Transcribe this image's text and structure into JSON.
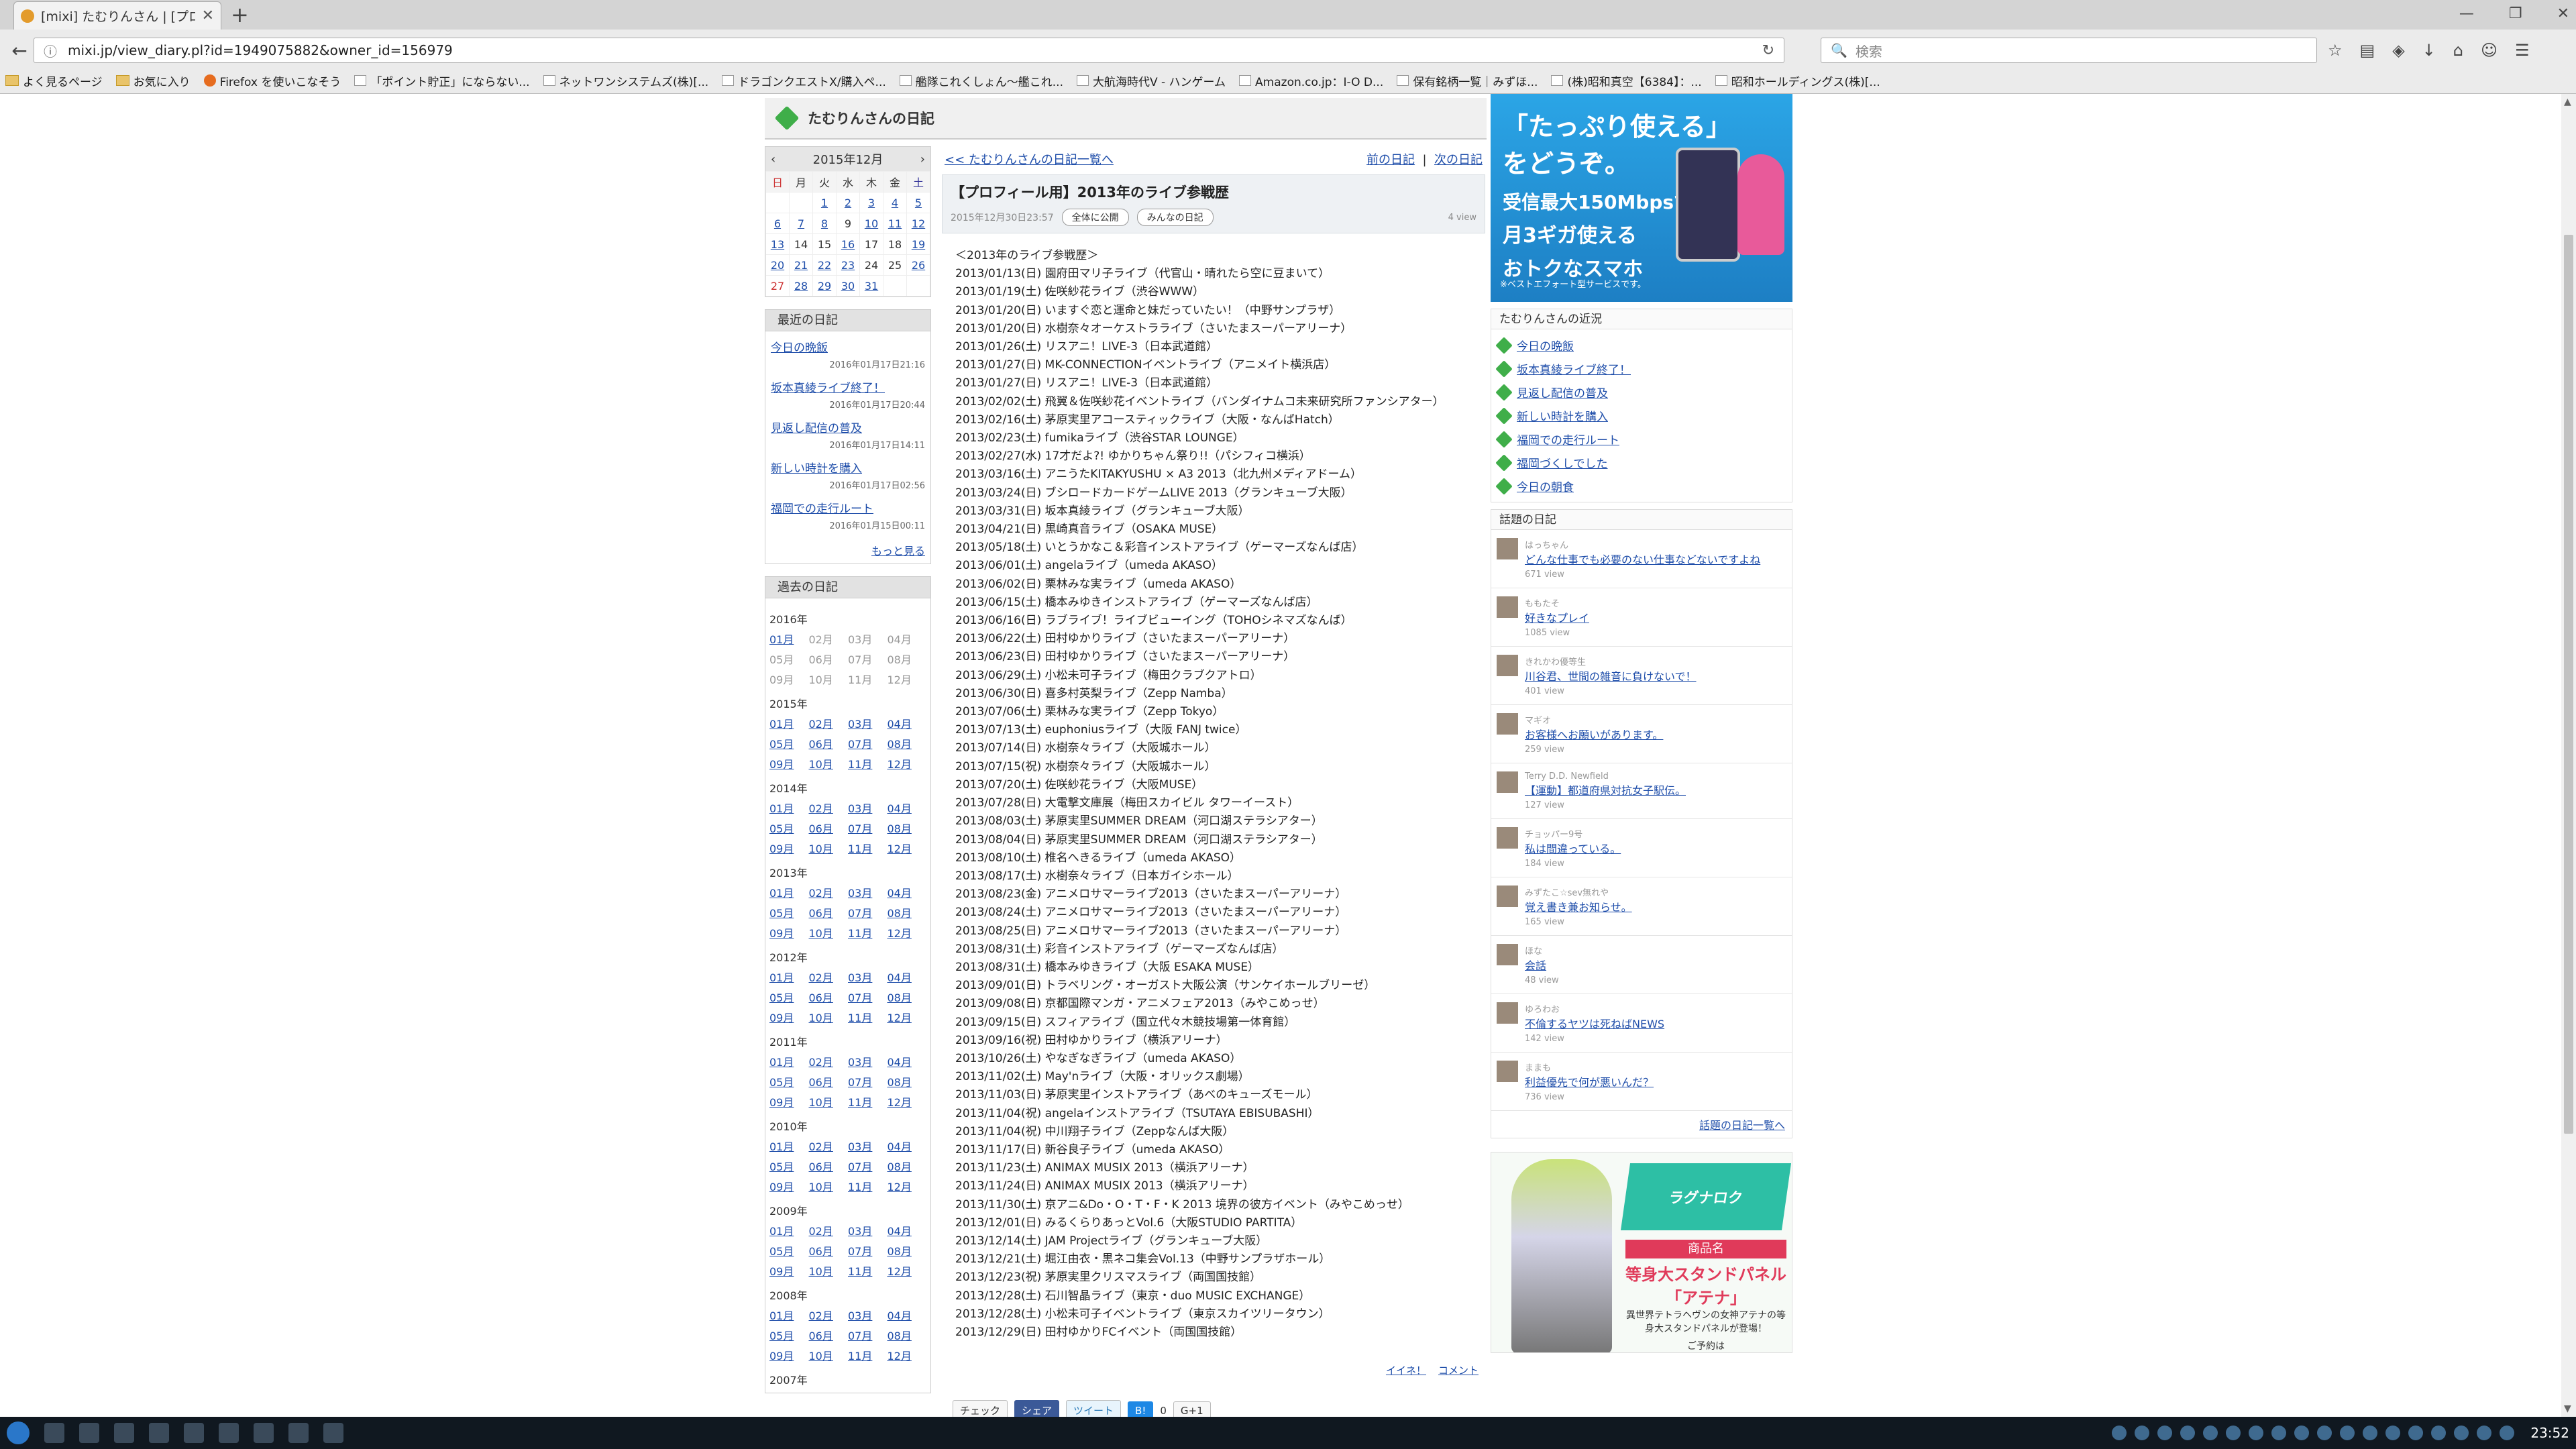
{
  "browser": {
    "tab_title": "[mixi] たむりんさん | [プロフィ...",
    "url": "mixi.jp/view_diary.pl?id=1949075882&owner_id=156979",
    "search_placeholder": "検索",
    "bookmarks": [
      "よく見るページ",
      "お気に入り",
      "Firefox を使いこなそう",
      "「ポイント貯正」にならない...",
      "ネットワンシステムズ(株)[...",
      "ドラゴンクエストX/購入ペ...",
      "艦隊これくしょん～艦これ...",
      "大航海時代Ⅴ - ハンゲーム",
      "Amazon.co.jp：I-O D...",
      "保有銘柄一覧｜みずほ...",
      "(株)昭和真空【6384】：...",
      "昭和ホールディングス(株)[..."
    ],
    "clock": "23:52"
  },
  "header": {
    "title": "たむりんさんの日記"
  },
  "calendar": {
    "month_label": "2015年12月",
    "weekdays": [
      "日",
      "月",
      "火",
      "水",
      "木",
      "金",
      "土"
    ],
    "weeks": [
      [
        "",
        "",
        "1",
        "2",
        "3",
        "4",
        "5"
      ],
      [
        "6",
        "7",
        "8",
        "9",
        "10",
        "11",
        "12"
      ],
      [
        "13",
        "14",
        "15",
        "16",
        "17",
        "18",
        "19"
      ],
      [
        "20",
        "21",
        "22",
        "23",
        "24",
        "25",
        "26"
      ],
      [
        "27",
        "28",
        "29",
        "30",
        "31",
        "",
        ""
      ]
    ]
  },
  "recent": {
    "title": "最近の日記",
    "items": [
      {
        "label": "今日の晩飯",
        "date": "2016年01月17日21:16"
      },
      {
        "label": "坂本真綾ライブ終了！",
        "date": "2016年01月17日20:44"
      },
      {
        "label": "見返し配信の普及",
        "date": "2016年01月17日14:11"
      },
      {
        "label": "新しい時計を購入",
        "date": "2016年01月17日02:56"
      },
      {
        "label": "福岡での走行ルート",
        "date": "2016年01月15日00:11"
      }
    ],
    "more": "もっと見る"
  },
  "archive": {
    "title": "過去の日記",
    "years": [
      {
        "year": "2016年",
        "months": [
          "01月",
          "02月",
          "03月",
          "04月",
          "05月",
          "06月",
          "07月",
          "08月",
          "09月",
          "10月",
          "11月",
          "12月"
        ],
        "links": [
          0
        ]
      },
      {
        "year": "2015年",
        "months": [
          "01月",
          "02月",
          "03月",
          "04月",
          "05月",
          "06月",
          "07月",
          "08月",
          "09月",
          "10月",
          "11月",
          "12月"
        ],
        "links": [
          0,
          1,
          2,
          3,
          4,
          5,
          6,
          7,
          8,
          9,
          10,
          11
        ]
      },
      {
        "year": "2014年",
        "months": [
          "01月",
          "02月",
          "03月",
          "04月",
          "05月",
          "06月",
          "07月",
          "08月",
          "09月",
          "10月",
          "11月",
          "12月"
        ],
        "links": [
          0,
          1,
          2,
          3,
          4,
          5,
          6,
          7,
          8,
          9,
          10,
          11
        ]
      },
      {
        "year": "2013年",
        "months": [
          "01月",
          "02月",
          "03月",
          "04月",
          "05月",
          "06月",
          "07月",
          "08月",
          "09月",
          "10月",
          "11月",
          "12月"
        ],
        "links": [
          0,
          1,
          2,
          3,
          4,
          5,
          6,
          7,
          8,
          9,
          10,
          11
        ]
      },
      {
        "year": "2012年",
        "months": [
          "01月",
          "02月",
          "03月",
          "04月",
          "05月",
          "06月",
          "07月",
          "08月",
          "09月",
          "10月",
          "11月",
          "12月"
        ],
        "links": [
          0,
          1,
          2,
          3,
          4,
          5,
          6,
          7,
          8,
          9,
          10,
          11
        ]
      },
      {
        "year": "2011年",
        "months": [
          "01月",
          "02月",
          "03月",
          "04月",
          "05月",
          "06月",
          "07月",
          "08月",
          "09月",
          "10月",
          "11月",
          "12月"
        ],
        "links": [
          0,
          1,
          2,
          3,
          4,
          5,
          6,
          7,
          8,
          9,
          10,
          11
        ]
      },
      {
        "year": "2010年",
        "months": [
          "01月",
          "02月",
          "03月",
          "04月",
          "05月",
          "06月",
          "07月",
          "08月",
          "09月",
          "10月",
          "11月",
          "12月"
        ],
        "links": [
          0,
          1,
          2,
          3,
          4,
          5,
          6,
          7,
          8,
          9,
          10,
          11
        ]
      },
      {
        "year": "2009年",
        "months": [
          "01月",
          "02月",
          "03月",
          "04月",
          "05月",
          "06月",
          "07月",
          "08月",
          "09月",
          "10月",
          "11月",
          "12月"
        ],
        "links": [
          0,
          1,
          2,
          3,
          4,
          5,
          6,
          7,
          8,
          9,
          10,
          11
        ]
      },
      {
        "year": "2008年",
        "months": [
          "01月",
          "02月",
          "03月",
          "04月",
          "05月",
          "06月",
          "07月",
          "08月",
          "09月",
          "10月",
          "11月",
          "12月"
        ],
        "links": [
          0,
          1,
          2,
          3,
          4,
          5,
          6,
          7,
          8,
          9,
          10,
          11
        ]
      },
      {
        "year": "2007年",
        "months": [],
        "links": []
      }
    ]
  },
  "entry": {
    "nav_list": "<< たむりんさんの日記一覧へ",
    "nav_prev": "前の日記",
    "nav_next": "次の日記",
    "title": "【プロフィール用】2013年のライブ参戦歴",
    "datetime": "2015年12月30日23:57",
    "pill1": "全体に公開",
    "pill2": "みんなの日記",
    "views": "4 view",
    "body": "＜2013年のライブ参戦歴＞\n2013/01/13(日) 園府田マリ子ライブ（代官山・晴れたら空に豆まいて）\n2013/01/19(土) 佐咲紗花ライブ（渋谷WWW）\n2013/01/20(日) いますぐ恋と運命と妹だっていたい！（中野サンプラザ）\n2013/01/20(日) 水樹奈々オーケストラライブ（さいたまスーパーアリーナ）\n2013/01/26(土) リスアニ！LIVE-3（日本武道館）\n2013/01/27(日) MK-CONNECTIONイベントライブ（アニメイト横浜店）\n2013/01/27(日) リスアニ！LIVE-3（日本武道館）\n2013/02/02(土) 飛翼＆佐咲紗花イベントライブ（バンダイナムコ未来研究所ファンシアター）\n2013/02/16(土) 茅原実里アコースティックライブ（大阪・なんばHatch）\n2013/02/23(土) fumikaライブ（渋谷STAR LOUNGE）\n2013/02/27(水) 17才だよ?! ゆかりちゃん祭り!!（パシフィコ横浜）\n2013/03/16(土) アニうたKITAKYUSHU × A3 2013（北九州メディアドーム）\n2013/03/24(日) ブシロードカードゲームLIVE 2013（グランキューブ大阪）\n2013/03/31(日) 坂本真綾ライブ（グランキューブ大阪）\n2013/04/21(日) 黒崎真音ライブ（OSAKA MUSE）\n2013/05/18(土) いとうかなこ＆彩音インストアライブ（ゲーマーズなんば店）\n2013/06/01(土) angelaライブ（umeda AKASO）\n2013/06/02(日) 栗林みな実ライブ（umeda AKASO）\n2013/06/15(土) 橋本みゆきインストアライブ（ゲーマーズなんば店）\n2013/06/16(日) ラブライブ！ライブビューイング（TOHOシネマズなんば）\n2013/06/22(土) 田村ゆかりライブ（さいたまスーパーアリーナ）\n2013/06/23(日) 田村ゆかりライブ（さいたまスーパーアリーナ）\n2013/06/29(土) 小松未可子ライブ（梅田クラブクアトロ）\n2013/06/30(日) 喜多村英梨ライブ（Zepp Namba）\n2013/07/06(土) 栗林みな実ライブ（Zepp Tokyo）\n2013/07/13(土) euphoniusライブ（大阪 FANJ twice）\n2013/07/14(日) 水樹奈々ライブ（大阪城ホール）\n2013/07/15(祝) 水樹奈々ライブ（大阪城ホール）\n2013/07/20(土) 佐咲紗花ライブ（大阪MUSE）\n2013/07/28(日) 大電撃文庫展（梅田スカイビル タワーイースト）\n2013/08/03(土) 茅原実里SUMMER DREAM（河口湖ステラシアター）\n2013/08/04(日) 茅原実里SUMMER DREAM（河口湖ステラシアター）\n2013/08/10(土) 椎名へきるライブ（umeda AKASO）\n2013/08/17(土) 水樹奈々ライブ（日本ガイシホール）\n2013/08/23(金) アニメロサマーライブ2013（さいたまスーパーアリーナ）\n2013/08/24(土) アニメロサマーライブ2013（さいたまスーパーアリーナ）\n2013/08/25(日) アニメロサマーライブ2013（さいたまスーパーアリーナ）\n2013/08/31(土) 彩音インストアライブ（ゲーマーズなんば店）\n2013/08/31(土) 橋本みゆきライブ（大阪 ESAKA MUSE）\n2013/09/01(日) トラベリング・オーガスト大阪公演（サンケイホールブリーゼ）\n2013/09/08(日) 京都国際マンガ・アニメフェア2013（みやこめっせ）\n2013/09/15(日) スフィアライブ（国立代々木競技場第一体育館）\n2013/09/16(祝) 田村ゆかりライブ（横浜アリーナ）\n2013/10/26(土) やなぎなぎライブ（umeda AKASO）\n2013/11/02(土) May'nライブ（大阪・オリックス劇場）\n2013/11/03(日) 茅原実里インストアライブ（あべのキューズモール）\n2013/11/04(祝) angelaインストアライブ（TSUTAYA EBISUBASHI）\n2013/11/04(祝) 中川翔子ライブ（Zeppなんば大阪）\n2013/11/17(日) 新谷良子ライブ（umeda AKASO）\n2013/11/23(土) ANIMAX MUSIX 2013（横浜アリーナ）\n2013/11/24(日) ANIMAX MUSIX 2013（横浜アリーナ）\n2013/11/30(土) 京アニ&Do・O・T・F・K 2013 境界の彼方イベント（みやこめっせ）\n2013/12/01(日) みるくらりあっとVol.6（大阪STUDIO PARTITA）\n2013/12/14(土) JAM Projectライブ（グランキューブ大阪）\n2013/12/21(土) 堀江由衣・黒ネコ集会Vol.13（中野サンプラザホール）\n2013/12/23(祝) 茅原実里クリスマスライブ（両国国技館）\n2013/12/28(土) 石川智晶ライブ（東京・duo MUSIC EXCHANGE）\n2013/12/28(土) 小松未可子イベントライブ（東京スカイツリータウン）\n2013/12/29(日) 田村ゆかりFCイベント（両国国技館）",
    "iine": "イイネ！",
    "comment": "コメント",
    "share": {
      "check": "チェック",
      "fb": "シェア",
      "tw": "ツイート",
      "hb_count": "0",
      "gplus": "G+1"
    }
  },
  "ad1": {
    "l1": "「たっぷり使える」",
    "l2": "をどうぞ。",
    "l3": "受信最大150Mbpsで",
    "l4": "月3ギガ使える",
    "l5": "おトクなスマホ",
    "note": "※ベストエフォート型サービスです。"
  },
  "recent_status": {
    "title": "たむりんさんの近況",
    "items": [
      "今日の晩飯",
      "坂本真綾ライブ終了！",
      "見返し配信の普及",
      "新しい時計を購入",
      "福岡での走行ルート",
      "福岡づくしでした",
      "今日の朝食"
    ]
  },
  "topics": {
    "title": "話題の日記",
    "items": [
      {
        "name": "はっちゃん",
        "title": "どんな仕事でも必要のない仕事などないですよね",
        "views": "671 view"
      },
      {
        "name": "ももたそ",
        "title": "好きなプレイ",
        "views": "1085 view"
      },
      {
        "name": "きれかわ優等生",
        "title": "川谷君、世間の雑音に負けないで！",
        "views": "401 view"
      },
      {
        "name": "マギオ",
        "title": "お客様へお願いがあります。",
        "views": "259 view"
      },
      {
        "name": "Terry D.D. Newfield",
        "title": "【運動】都道府県対抗女子駅伝。",
        "views": "127 view"
      },
      {
        "name": "チョッパー9号",
        "title": "私は間違っている。",
        "views": "184 view"
      },
      {
        "name": "みずたこ☆sev無れや",
        "title": "覚え書き兼お知らせ。",
        "views": "165 view"
      },
      {
        "name": "ほな",
        "title": "会話",
        "views": "48 view"
      },
      {
        "name": "ゆろわお",
        "title": "不倫するヤツは死ねばNEWS",
        "views": "142 view"
      },
      {
        "name": "ままも",
        "title": "利益優先で何が悪いんだ？",
        "views": "736 view"
      }
    ],
    "more": "話題の日記一覧へ"
  },
  "ad2": {
    "logo": "ラグナロク",
    "b1": "商品名",
    "b2": "等身大スタンドパネル「アテナ」",
    "b3": "異世界テトラヘヴンの女神アテナの等身大スタンドパネルが登場！",
    "b4": "ご予約は"
  }
}
